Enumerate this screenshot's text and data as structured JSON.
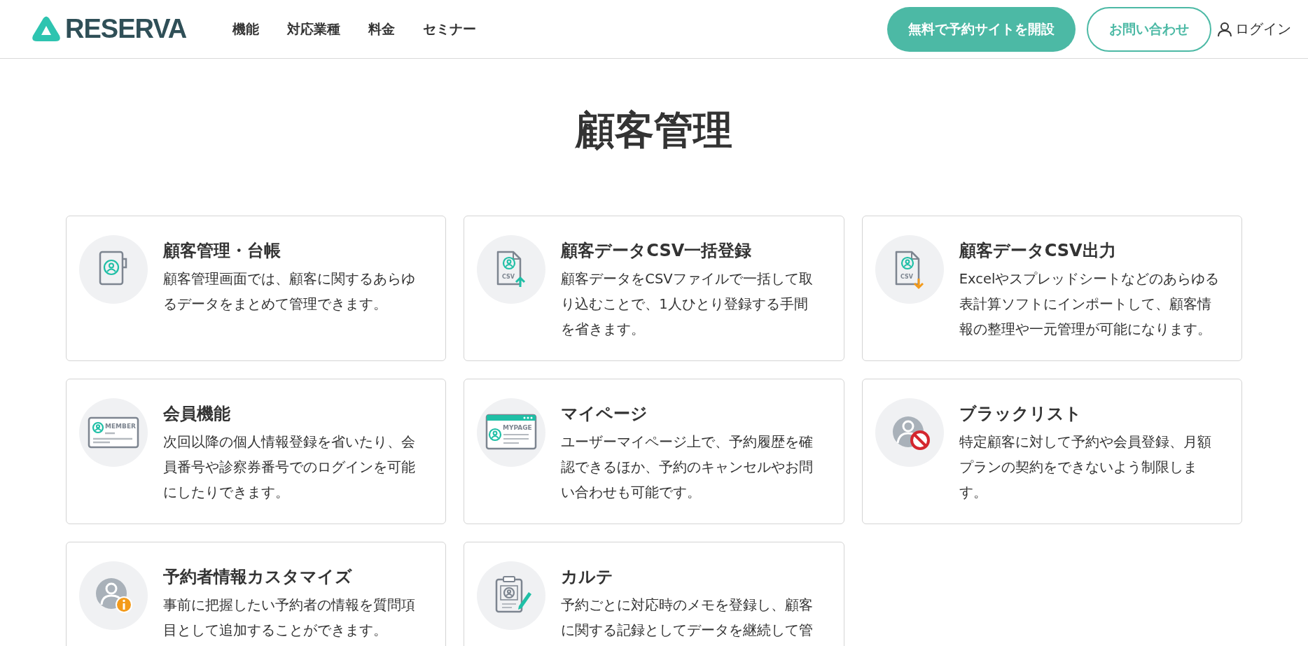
{
  "header": {
    "logo": "RESERVA",
    "nav": [
      "機能",
      "対応業種",
      "料金",
      "セミナー"
    ],
    "actions": [
      {
        "kind": "primary",
        "label": "無料で予約サイトを開設"
      },
      {
        "kind": "outline",
        "label": "お問い合わせ"
      }
    ],
    "login": "ログイン"
  },
  "title": "顧客管理",
  "cards": [
    {
      "kind": "binder",
      "title": "顧客管理・台帳",
      "description": "顧客管理画面では、顧客に関するあらゆるデータをまとめて管理できます。"
    },
    {
      "kind": "csv-upload",
      "icon_text": "CSV",
      "title": "顧客データCSV一括登録",
      "description": "顧客データをCSVファイルで一括して取り込むことで、1人ひとり登録する手間を省きます。"
    },
    {
      "kind": "csv-download",
      "icon_text": "CSV",
      "title": "顧客データCSV出力",
      "description": "Excelやスプレッドシートなどのあらゆる表計算ソフトにインポートして、顧客情報の整理や一元管理が可能になります。"
    },
    {
      "kind": "member-card",
      "icon_text": "MEMBER",
      "title": "会員機能",
      "description": "次回以降の個人情報登録を省いたり、会員番号や診察券番号でのログインを可能にしたりできます。"
    },
    {
      "kind": "mypage",
      "icon_text": "MYPAGE",
      "title": "マイページ",
      "description": "ユーザーマイページ上で、予約履歴を確認できるほか、予約のキャンセルやお問い合わせも可能です。"
    },
    {
      "kind": "blocked-user",
      "title": "ブラックリスト",
      "description": "特定顧客に対して予約や会員登録、月額プランの契約をできないよう制限します。"
    },
    {
      "kind": "user-info",
      "title": "予約者情報カスタマイズ",
      "description": "事前に把握したい予約者の情報を質問項目として追加することができます。"
    },
    {
      "kind": "clipboard",
      "title": "カルテ",
      "description": "予約ごとに対応時のメモを登録し、顧客に関する記録としてデータを継続して管"
    }
  ]
}
